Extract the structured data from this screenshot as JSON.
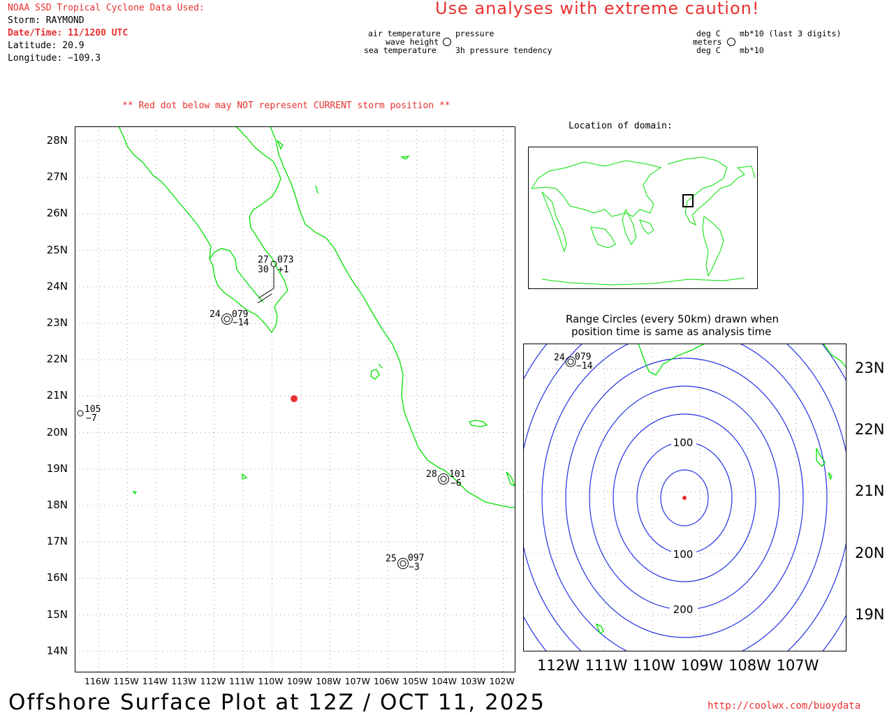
{
  "header": {
    "source": "NOAA SSD Tropical Cyclone Data Used:",
    "storm": "Storm: RAYMOND",
    "datetime": "Date/Time: 11/1200 UTC",
    "latitude": "Latitude: 20.9",
    "longitude": "Longitude: −109.3",
    "caution": "Use analyses with extreme caution!"
  },
  "legend": {
    "air_temp": "air temperature",
    "wave_height": "wave height",
    "sea_temp": "sea temperature",
    "pressure": "pressure",
    "pressure_tendency": "3h pressure tendency",
    "unit_air": "deg C",
    "unit_wave": "meters",
    "unit_sea": "deg C",
    "unit_pressure": "mb*10 (last 3 digits)",
    "unit_tendency": "mb*10"
  },
  "warning": "** Red dot below may NOT represent CURRENT storm position **",
  "main_map": {
    "lat_labels": [
      "28N",
      "27N",
      "26N",
      "25N",
      "24N",
      "23N",
      "22N",
      "21N",
      "20N",
      "19N",
      "18N",
      "17N",
      "16N",
      "15N",
      "14N"
    ],
    "lon_labels": [
      "116W",
      "115W",
      "114W",
      "113W",
      "112W",
      "111W",
      "110W",
      "109W",
      "108W",
      "107W",
      "106W",
      "105W",
      "104W",
      "103W",
      "102W"
    ],
    "storm_position": {
      "lat": 20.9,
      "lon": -109.3
    },
    "stations": [
      {
        "top": "27",
        "pressure": "073",
        "bottom_left": "30",
        "tendency": "+1"
      },
      {
        "top": "24",
        "pressure": "079",
        "tendency": "−14"
      },
      {
        "pressure": "105",
        "tendency": "−7"
      },
      {
        "top": "28",
        "pressure": "101",
        "tendency": "−6"
      },
      {
        "top": "25",
        "pressure": "097",
        "tendency": "−3"
      }
    ]
  },
  "domain_map": {
    "title": "Location of domain:"
  },
  "range_map": {
    "title_line1": "Range Circles (every 50km) drawn when",
    "title_line2": "position time is same as analysis time",
    "lat_labels": [
      "23N",
      "22N",
      "21N",
      "20N",
      "19N"
    ],
    "lon_labels": [
      "112W",
      "111W",
      "110W",
      "109W",
      "108W",
      "107W"
    ],
    "circle_labels": [
      "100",
      "100",
      "200"
    ],
    "station": {
      "top": "24",
      "pressure": "079",
      "tendency": "−14"
    },
    "circle_color": "#2030e0"
  },
  "footer": {
    "title": "Offshore Surface Plot at 12Z / OCT 11, 2025",
    "url": "http://coolwx.com/buoydata"
  },
  "colors": {
    "coast": "#00e000",
    "storm": "#e83030",
    "grid": "#999999"
  }
}
